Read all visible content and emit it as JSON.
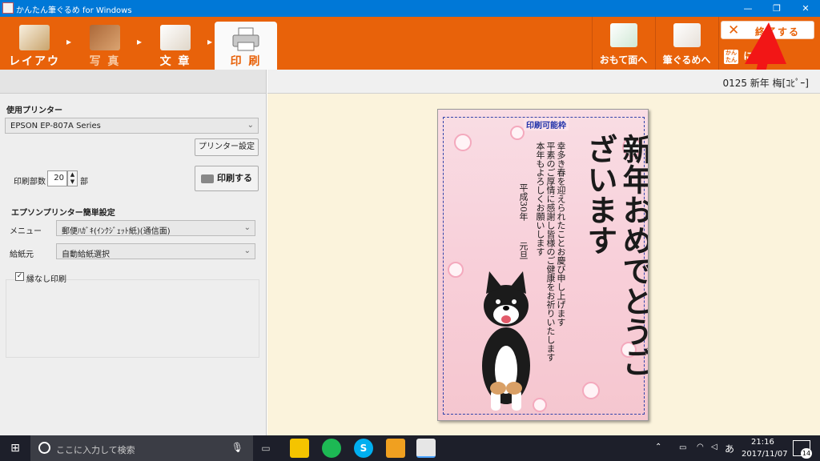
{
  "window": {
    "title": "かんたん筆ぐるめ for Windows",
    "minimize": "—",
    "restore": "❐",
    "close": "✕"
  },
  "toolbar": {
    "tabs": [
      {
        "label": "レイアウト",
        "state": "normal"
      },
      {
        "label": "写 真",
        "state": "dim"
      },
      {
        "label": "文 章",
        "state": "normal"
      },
      {
        "label": "印 刷",
        "state": "active"
      }
    ],
    "omote_label": "おもて面へ",
    "fudegurume_label": "筆ぐるめへ",
    "quit_label": "終了する",
    "back_badge": "かんたん",
    "back_label": "に戻る"
  },
  "left": {
    "printer_label": "使用プリンター",
    "printer_value": "EPSON EP-807A Series",
    "printer_settings_label": "プリンター設定",
    "copies_label": "印刷部数",
    "copies_value": "20",
    "copies_unit": "部",
    "print_button_label": "印刷する",
    "epson_group_label": "エプソンプリンター簡単設定",
    "menu_label": "メニュー",
    "menu_value": "郵便ﾊｶﾞｷ(ｲﾝｸｼﾞｪｯﾄ紙)(通信面)",
    "feed_label": "給紙元",
    "feed_value": "自動給紙選択",
    "borderless_label": "縁なし印刷",
    "borderless_checked": true
  },
  "right": {
    "header_name": "0125 新年 梅[ｺﾋﾟｰ]",
    "printable_area_label": "印刷可能枠",
    "card_greeting": "新年おめでとうございます",
    "card_message_1": "幸多き春を迎えられたことお慶び申し上げます",
    "card_message_2": "平素のご厚情に感謝し皆様のご健康をお祈りいたします",
    "card_message_3": "本年もよろしくお願いします",
    "card_date_year": "平成30年",
    "card_date_day": "元旦"
  },
  "taskbar": {
    "search_placeholder": "ここに入力して検索",
    "time": "21:16",
    "date": "2017/11/07",
    "ime": "あ",
    "notification_count": "14"
  },
  "colors": {
    "toolbar": "#e8620a",
    "titlebar": "#0078d7",
    "canvas": "#fbf3dc",
    "taskbar": "#1d1f2a"
  },
  "icons": [
    "windows-logo-icon",
    "search-icon",
    "microphone-icon",
    "task-view-icon",
    "spotify-icon",
    "skype-icon",
    "printer-icon",
    "close-icon",
    "chevron-right-icon"
  ]
}
